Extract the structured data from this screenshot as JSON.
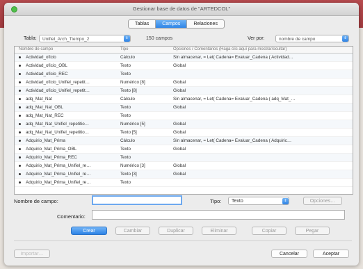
{
  "window": {
    "title": "Gestionar base de datos de \"ARTEDCOL\""
  },
  "tabs": [
    {
      "label": "Tablas",
      "active": false
    },
    {
      "label": "Campos",
      "active": true
    },
    {
      "label": "Relaciones",
      "active": false
    }
  ],
  "filter": {
    "table_label": "Tabla:",
    "table_value": "Unifiel_Arch_Tiempo_2",
    "count": "150 campos",
    "view_label": "Ver por:",
    "view_value": "nombre de campo"
  },
  "table": {
    "headers": [
      "Nombre de campo",
      "Tipo",
      "Opciones / Comentarios (Haga clic aquí para mostrar/ocultar)"
    ],
    "rows": [
      {
        "name": "Actividad_oficio",
        "type": "Cálculo",
        "options": "Sin almacenar, = Let( Cadena= Evaluar_Cadena ( Actividad…"
      },
      {
        "name": "Actividad_oficio_OBL",
        "type": "Texto",
        "options": "Global"
      },
      {
        "name": "Actividad_oficio_REC",
        "type": "Texto",
        "options": ""
      },
      {
        "name": "Actividad_oficio_Unifiel_repetit…",
        "type": "Numérico [8]",
        "options": "Global"
      },
      {
        "name": "Actividad_oficio_Unifiel_repetit…",
        "type": "Texto [8]",
        "options": "Global"
      },
      {
        "name": "adq_Mat_Nat",
        "type": "Cálculo",
        "options": "Sin almacenar, = Let( Cadena= Evaluar_Cadena ( adq_Mat_…"
      },
      {
        "name": "adq_Mat_Nat_OBL",
        "type": "Texto",
        "options": "Global"
      },
      {
        "name": "adq_Mat_Nat_REC",
        "type": "Texto",
        "options": ""
      },
      {
        "name": "adq_Mat_Nat_Unifiel_repetitio…",
        "type": "Numérico [5]",
        "options": "Global"
      },
      {
        "name": "adq_Mat_Nat_Unifiel_repetitio…",
        "type": "Texto [5]",
        "options": "Global"
      },
      {
        "name": "Adquirio_Mat_Prima",
        "type": "Cálculo",
        "options": "Sin almacenar, = Let( Cadena= Evaluar_Cadena ( Adquiric…"
      },
      {
        "name": "Adquirio_Mat_Prima_OBL",
        "type": "Texto",
        "options": "Global"
      },
      {
        "name": "Adquirio_Mat_Prima_REC",
        "type": "Texto",
        "options": ""
      },
      {
        "name": "Adquirio_Mat_Prima_Unifiel_re…",
        "type": "Numérico [3]",
        "options": "Global"
      },
      {
        "name": "Adquirio_Mat_Prima_Unifiel_re…",
        "type": "Texto [3]",
        "options": "Global"
      },
      {
        "name": "Adquirio_Mat_Prima_Unifiel_re…",
        "type": "Texto",
        "options": ""
      }
    ]
  },
  "form": {
    "field_name_label": "Nombre de campo:",
    "field_name_value": "",
    "type_label": "Tipo:",
    "type_value": "Texto",
    "options_button": "Opciones…",
    "comment_label": "Comentario:",
    "comment_value": ""
  },
  "actions": [
    "Crear",
    "Cambiar",
    "Duplicar",
    "Eliminar",
    "Copiar",
    "Pegar"
  ],
  "footer": {
    "import": "Importar…",
    "cancel": "Cancelar",
    "accept": "Aceptar"
  }
}
